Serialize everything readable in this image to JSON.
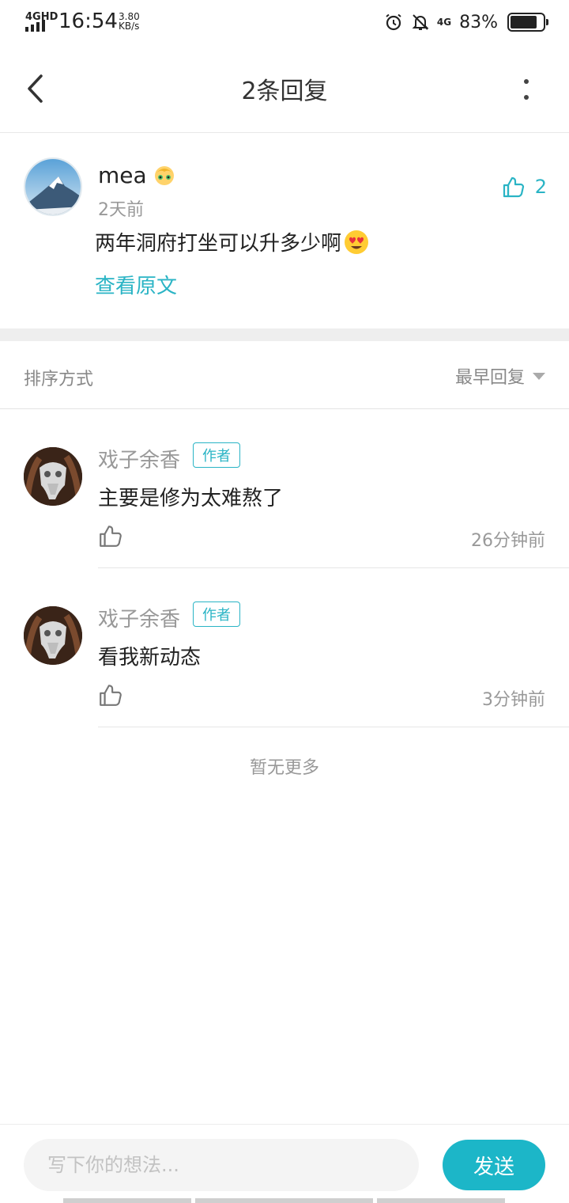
{
  "status_bar": {
    "network_label": "4GHD",
    "time": "16:54",
    "speed_value": "3.80",
    "speed_unit": "KB/s",
    "mobile_label": "4G",
    "battery_percent_text": "83%",
    "battery_level": 0.83
  },
  "header": {
    "title": "2条回复",
    "back_icon": "chevron-left-icon",
    "more_icon": "more-vertical-icon"
  },
  "post": {
    "author": "mea",
    "time": "2天前",
    "content": "两年洞府打坐可以升多少啊",
    "content_emoji": "heart-eyes-emoji",
    "view_original_label": "查看原文",
    "like_count": "2"
  },
  "sort": {
    "label": "排序方式",
    "selected": "最早回复"
  },
  "replies": [
    {
      "author": "戏子余香",
      "badge": "作者",
      "text": "主要是修为太难熬了",
      "time": "26分钟前"
    },
    {
      "author": "戏子余香",
      "badge": "作者",
      "text": "看我新动态",
      "time": "3分钟前"
    }
  ],
  "no_more_text": "暂无更多",
  "bottom_bar": {
    "input_placeholder": "写下你的想法...",
    "send_label": "发送"
  },
  "colors": {
    "accent": "#2ab4c5",
    "send_button": "#1cb6c8",
    "secondary_text": "#999999"
  }
}
